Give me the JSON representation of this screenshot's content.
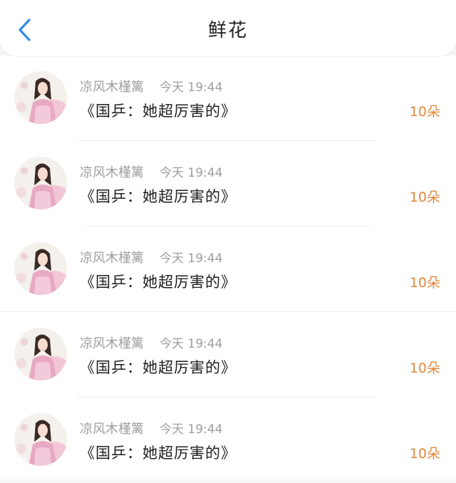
{
  "header": {
    "title": "鲜花",
    "back_icon": "chevron-left-icon",
    "accent": "#2f8de4"
  },
  "items": [
    {
      "user": "凉风木槿篱",
      "time": "今天 19:44",
      "book": "《国乒：她超厉害的》",
      "count": "10朵"
    },
    {
      "user": "凉风木槿篱",
      "time": "今天 19:44",
      "book": "《国乒：她超厉害的》",
      "count": "10朵"
    },
    {
      "user": "凉风木槿篱",
      "time": "今天 19:44",
      "book": "《国乒：她超厉害的》",
      "count": "10朵"
    },
    {
      "user": "凉风木槿篱",
      "time": "今天 19:44",
      "book": "《国乒：她超厉害的》",
      "count": "10朵"
    },
    {
      "user": "凉风木槿篱",
      "time": "今天 19:44",
      "book": "《国乒：她超厉害的》",
      "count": "10朵"
    }
  ],
  "colors": {
    "count": "#e3883b",
    "meta": "#9e9e9e"
  }
}
